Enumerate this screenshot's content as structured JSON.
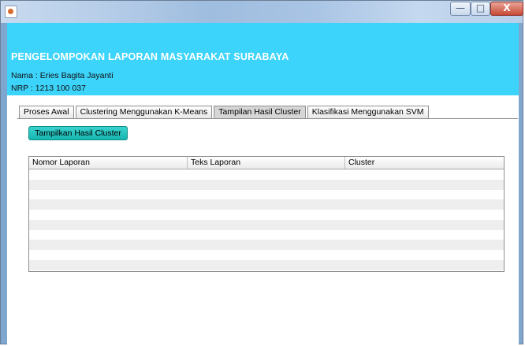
{
  "window": {
    "minimize": "—",
    "maximize": "□",
    "close": "X"
  },
  "app": {
    "title": "PENGELOMPOKAN LAPORAN MASYARAKAT SURABAYA",
    "nama": "Nama : Eries Bagita Jayanti",
    "nrp": "NRP : 1213 100 037"
  },
  "tabs": [
    {
      "label": "Proses Awal"
    },
    {
      "label": "Clustering Menggunakan K-Means"
    },
    {
      "label": "Tampilan Hasil Cluster"
    },
    {
      "label": "Klasifikasi Menggunakan SVM"
    }
  ],
  "active_tab": "Tampilan Hasil Cluster",
  "panel": {
    "show_button": "Tampilkan Hasil Cluster",
    "table": {
      "columns": [
        "Nomor Laporan",
        "Teks Laporan",
        "Cluster"
      ],
      "rows": []
    }
  },
  "colors": {
    "header_bg": "#3cd4fb",
    "button_bg": "#1fc3be"
  }
}
